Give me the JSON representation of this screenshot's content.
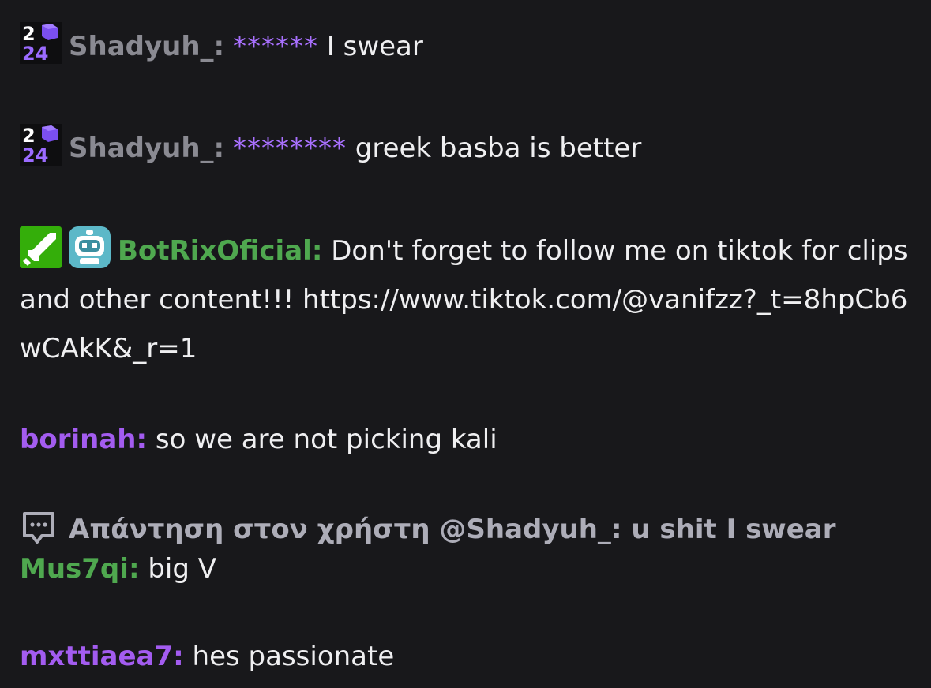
{
  "messages": [
    {
      "username": "Shadyuh_",
      "colon": ":",
      "censored": "******",
      "text": " I swear",
      "badges": [
        "2024-badge-icon"
      ],
      "color": "#8a8a92"
    },
    {
      "username": "Shadyuh_",
      "colon": ":",
      "censored": "********",
      "text": " greek basba is better",
      "badges": [
        "2024-badge-icon"
      ],
      "color": "#8a8a92"
    },
    {
      "username": "BotRixOficial",
      "colon": ":",
      "text": " Don't forget to follow me on tiktok for clips and other content!!!   https://www.tiktok.com/@vanifzz?_t=8hpCb6wCAkK&_r=1",
      "badges": [
        "moderator-sword-badge-icon",
        "robot-bot-badge-icon"
      ],
      "color": "#4fa84f"
    },
    {
      "username": "borinah",
      "colon": ":",
      "text": " so we are not picking kali",
      "color": "#a35cf0"
    },
    {
      "username": "Mus7qi",
      "colon": ":",
      "text": " big V",
      "color": "#4fa84f",
      "reply": {
        "icon": "reply-speech-bubble-icon",
        "text": "Απάντηση στον χρήστη @Shadyuh_: u shit I swear"
      }
    },
    {
      "username": "mxttiaea7",
      "colon": ":",
      "text": " hes passionate",
      "color": "#a35cf0"
    }
  ],
  "badge_text": {
    "top": "2",
    "bottom": "24"
  },
  "colors": {
    "background": "#18181b",
    "text": "#efeff1",
    "censor": "#a970ff",
    "reply_text": "#adadb8",
    "mod_badge": "#34ae0a",
    "bot_badge": "#5cb8c8"
  }
}
